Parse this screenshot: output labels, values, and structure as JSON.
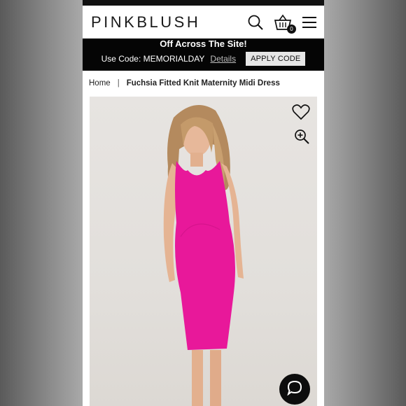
{
  "brand": {
    "logo_text": "PINKBLUSH"
  },
  "header": {
    "search_icon": "search-icon",
    "cart_icon": "shopping-basket-icon",
    "cart_count": "0",
    "menu_icon": "hamburger-menu-icon"
  },
  "promo": {
    "headline": "Off Across The Site!",
    "code_label": "Use Code: MEMORIALDAY",
    "details_link": "Details",
    "apply_button": "APPLY CODE"
  },
  "breadcrumb": {
    "home": "Home",
    "separator": "|",
    "current": "Fuchsia Fitted Knit Maternity Midi Dress"
  },
  "product": {
    "image_subject": "model wearing fuchsia fitted knit maternity midi dress",
    "dress_color": "#e8189a",
    "wishlist_icon": "heart-icon",
    "zoom_icon": "zoom-in-icon"
  },
  "chat": {
    "icon": "chat-bubble-icon"
  }
}
